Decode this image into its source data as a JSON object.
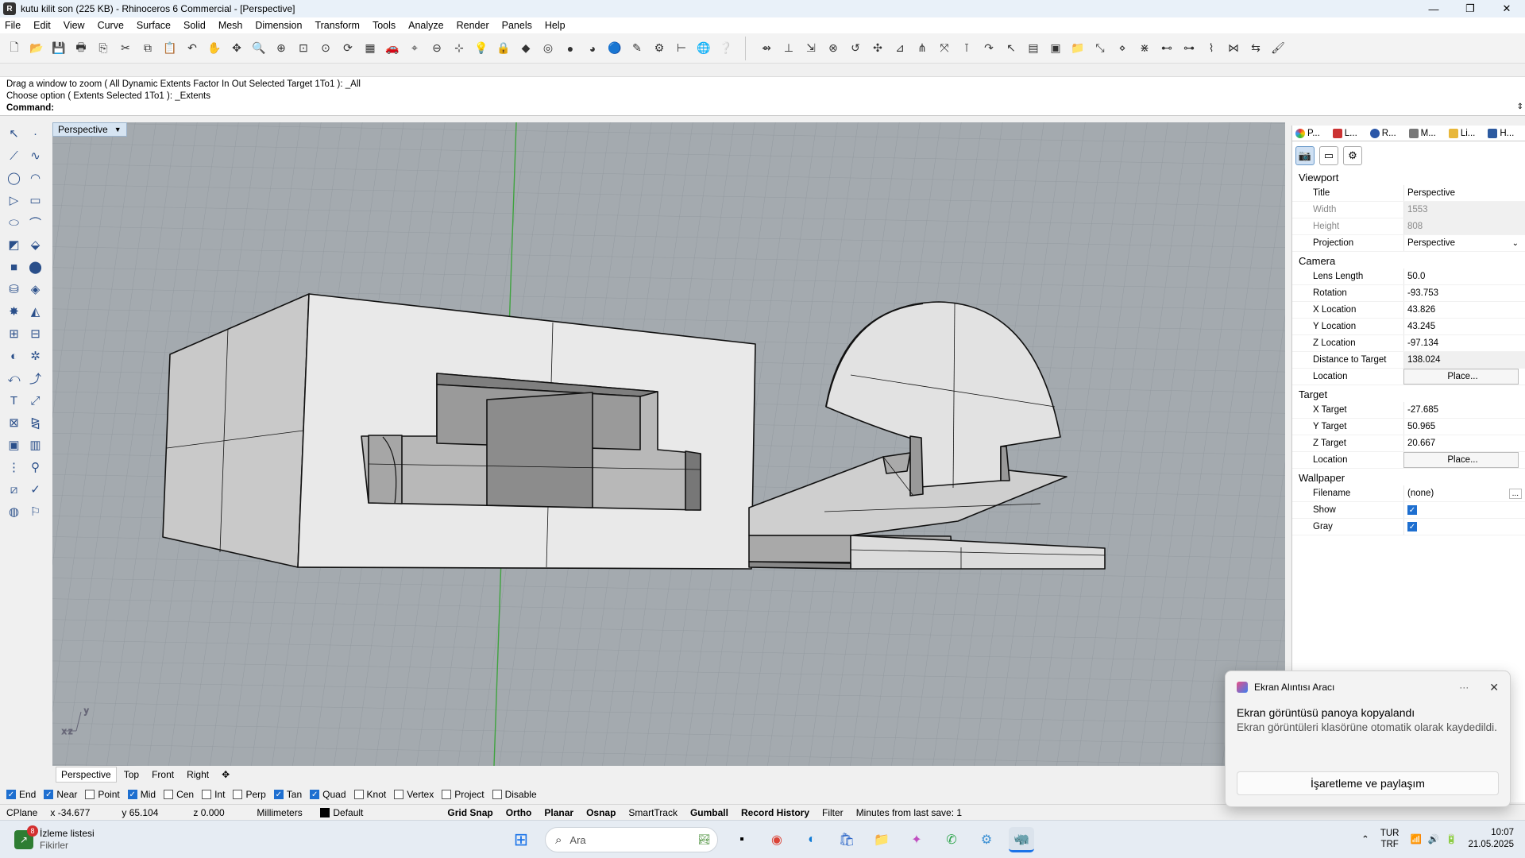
{
  "window": {
    "title": "kutu kilit son (225 KB) - Rhinoceros 6 Commercial - [Perspective]"
  },
  "menu": [
    "File",
    "Edit",
    "View",
    "Curve",
    "Surface",
    "Solid",
    "Mesh",
    "Dimension",
    "Transform",
    "Tools",
    "Analyze",
    "Render",
    "Panels",
    "Help"
  ],
  "command_history": [
    "Drag a window to zoom ( All  Dynamic  Extents  Factor  In  Out  Selected  Target  1To1 ): _All",
    "Choose option ( Extents  Selected  1To1 ): _Extents"
  ],
  "command_prompt": "Command:",
  "viewport": {
    "name": "Perspective",
    "axis_x": "x",
    "axis_y": "y",
    "axis_z": "z"
  },
  "viewport_tabs": [
    "Perspective",
    "Top",
    "Front",
    "Right"
  ],
  "osnaps": [
    {
      "label": "End",
      "checked": true
    },
    {
      "label": "Near",
      "checked": true
    },
    {
      "label": "Point",
      "checked": false
    },
    {
      "label": "Mid",
      "checked": true
    },
    {
      "label": "Cen",
      "checked": false
    },
    {
      "label": "Int",
      "checked": false
    },
    {
      "label": "Perp",
      "checked": false
    },
    {
      "label": "Tan",
      "checked": true
    },
    {
      "label": "Quad",
      "checked": true
    },
    {
      "label": "Knot",
      "checked": false
    },
    {
      "label": "Vertex",
      "checked": false
    },
    {
      "label": "Project",
      "checked": false
    },
    {
      "label": "Disable",
      "checked": false
    }
  ],
  "status": {
    "cplane": "CPlane",
    "x": "x -34.677",
    "y": "y 65.104",
    "z": "z 0.000",
    "units": "Millimeters",
    "layer": "Default",
    "grid_snap": "Grid Snap",
    "ortho": "Ortho",
    "planar": "Planar",
    "osnap": "Osnap",
    "smarttrack": "SmartTrack",
    "gumball": "Gumball",
    "record_history": "Record History",
    "filter": "Filter",
    "save_info": "Minutes from last save: 1"
  },
  "panel": {
    "tabs": [
      "P...",
      "L...",
      "R...",
      "M...",
      "Li...",
      "H..."
    ],
    "sections": {
      "viewport": "Viewport",
      "camera": "Camera",
      "target": "Target",
      "wallpaper": "Wallpaper"
    },
    "viewport_props": [
      {
        "k": "Title",
        "v": "Perspective"
      },
      {
        "k": "Width",
        "v": "1553"
      },
      {
        "k": "Height",
        "v": "808"
      },
      {
        "k": "Projection",
        "v": "Perspective"
      }
    ],
    "camera_props": [
      {
        "k": "Lens Length",
        "v": "50.0"
      },
      {
        "k": "Rotation",
        "v": "-93.753"
      },
      {
        "k": "X Location",
        "v": "43.826"
      },
      {
        "k": "Y Location",
        "v": "43.245"
      },
      {
        "k": "Z Location",
        "v": "-97.134"
      },
      {
        "k": "Distance to Target",
        "v": "138.024"
      },
      {
        "k": "Location",
        "v": "Place..."
      }
    ],
    "target_props": [
      {
        "k": "X Target",
        "v": "-27.685"
      },
      {
        "k": "Y Target",
        "v": "50.965"
      },
      {
        "k": "Z Target",
        "v": "20.667"
      },
      {
        "k": "Location",
        "v": "Place..."
      }
    ],
    "wallpaper_props": [
      {
        "k": "Filename",
        "v": "(none)"
      },
      {
        "k": "Show",
        "v": ""
      },
      {
        "k": "Gray",
        "v": ""
      }
    ]
  },
  "toast": {
    "app": "Ekran Alıntısı Aracı",
    "title": "Ekran görüntüsü panoya kopyalandı",
    "body": "Ekran görüntüleri klasörüne otomatik olarak kaydedildi.",
    "action": "İşaretleme ve paylaşım",
    "more": "···",
    "close": "✕"
  },
  "taskbar": {
    "widget_title": "İzleme listesi",
    "widget_sub": "Fikirler",
    "widget_badge": "8",
    "search_placeholder": "Ara",
    "lang_top": "TUR",
    "lang_bottom": "TRF",
    "time": "10:07",
    "date": "21.05.2025"
  }
}
